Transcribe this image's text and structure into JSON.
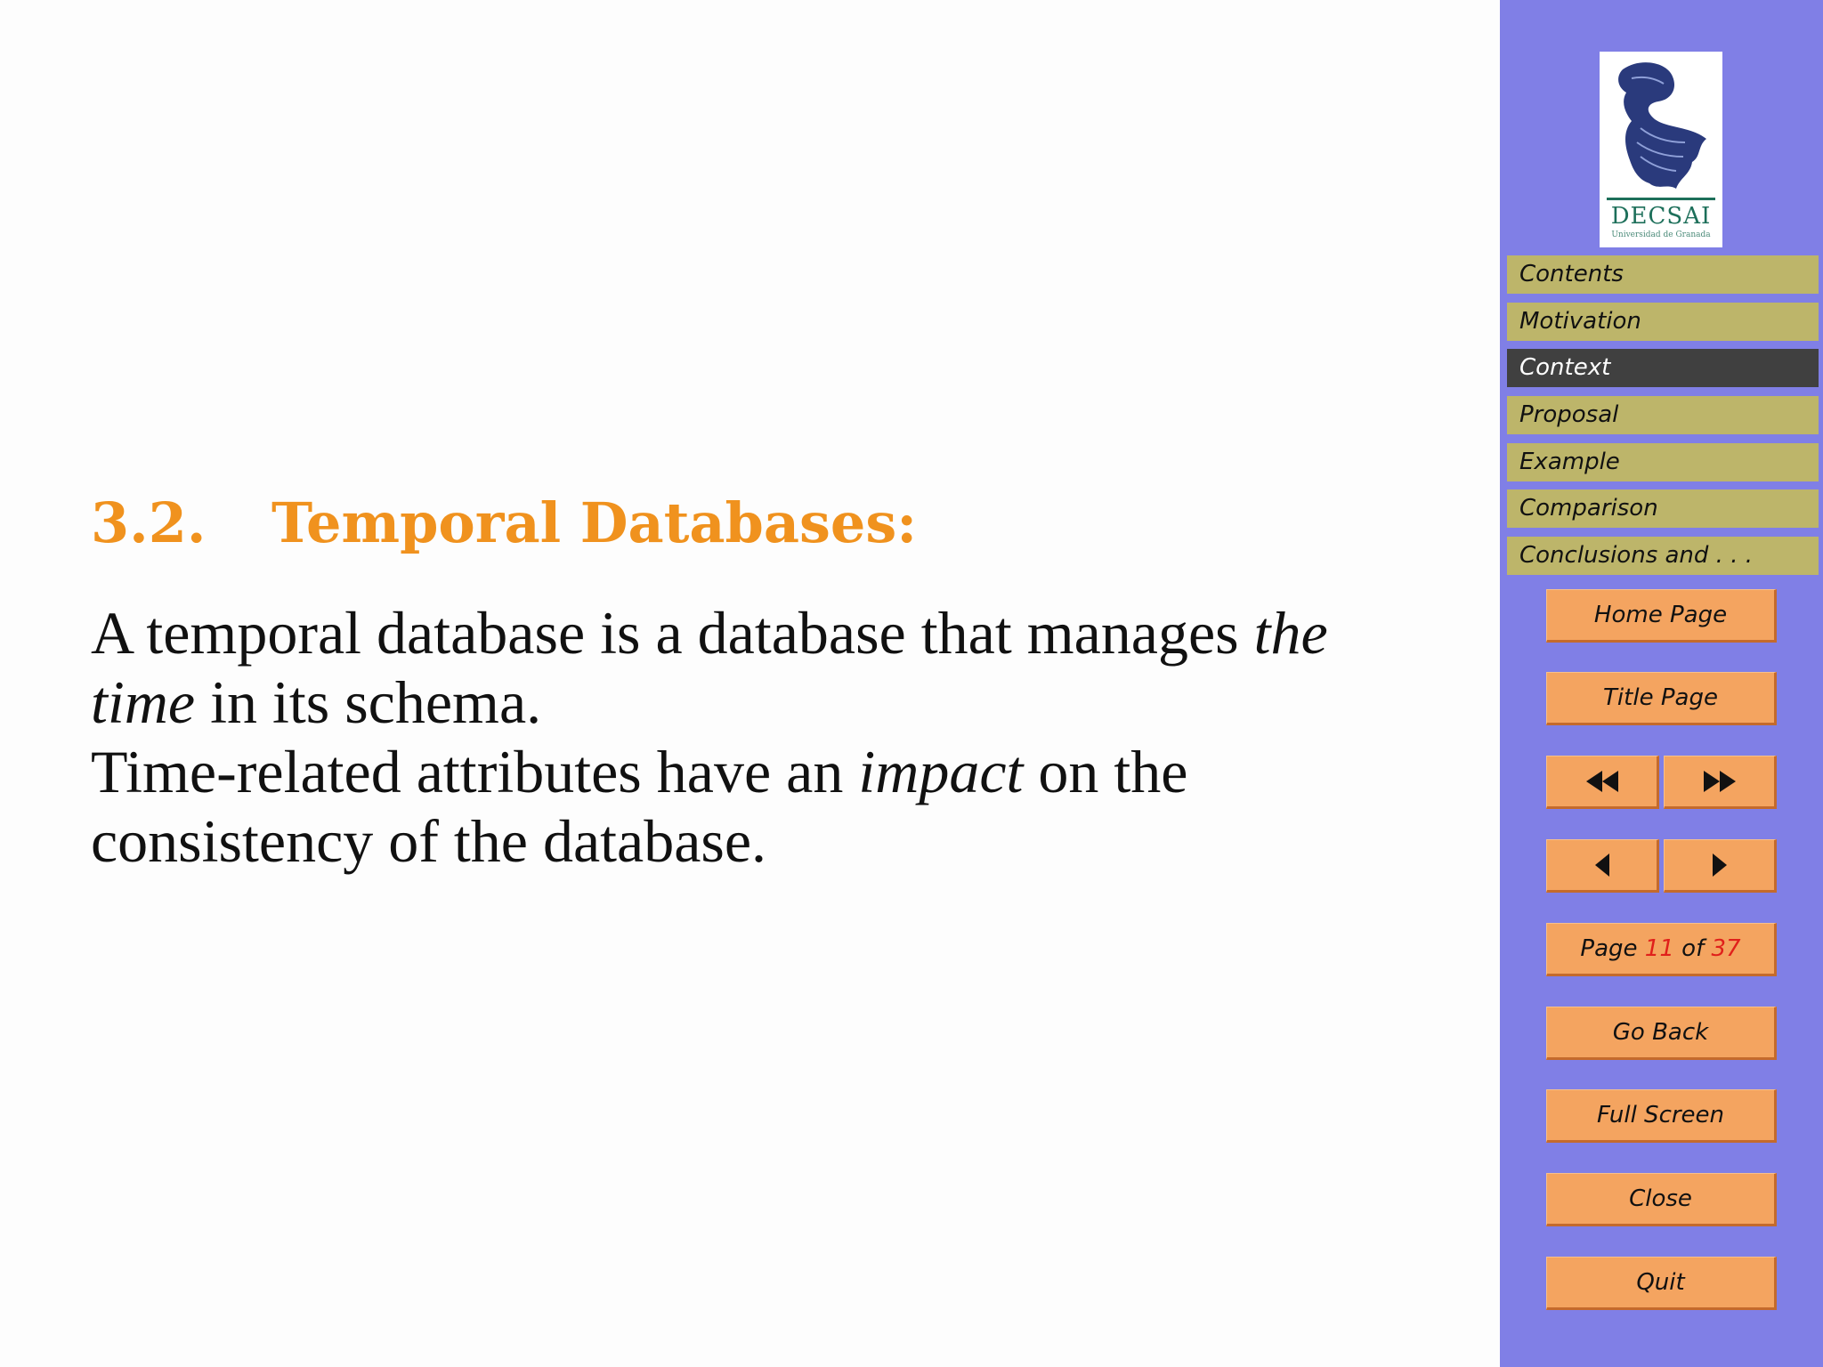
{
  "section": {
    "number": "3.2.",
    "title": "Temporal Databases:"
  },
  "body": {
    "p1_a": "A temporal database is a database that manages ",
    "p1_em": "the time",
    "p1_b": " in its schema.",
    "p2_a": "Time-related attributes have an ",
    "p2_em": "impact",
    "p2_b": " on the consistency of the database."
  },
  "logo": {
    "name": "DECSAI",
    "subtitle": "Universidad de Granada"
  },
  "nav": {
    "items": [
      {
        "label": "Contents"
      },
      {
        "label": "Motivation"
      },
      {
        "label": "Context",
        "active": true
      },
      {
        "label": "Proposal"
      },
      {
        "label": "Example"
      },
      {
        "label": "Comparison"
      },
      {
        "label": "Conclusions and . . ."
      }
    ]
  },
  "buttons": {
    "home": "Home Page",
    "title": "Title Page",
    "page_prefix": "Page",
    "page_current": "11",
    "page_of": "of",
    "page_total": "37",
    "go_back": "Go Back",
    "full_screen": "Full Screen",
    "close": "Close",
    "quit": "Quit"
  },
  "icons": {
    "first": "fast-backward-icon",
    "last": "fast-forward-icon",
    "prev": "previous-icon",
    "next": "next-icon"
  },
  "colors": {
    "heading": "#f0921e",
    "sidebar": "#807fe6",
    "nav_item": "#bdb56a",
    "nav_active": "#404040",
    "button": "#f4a460",
    "page_number": "#e0201b"
  }
}
